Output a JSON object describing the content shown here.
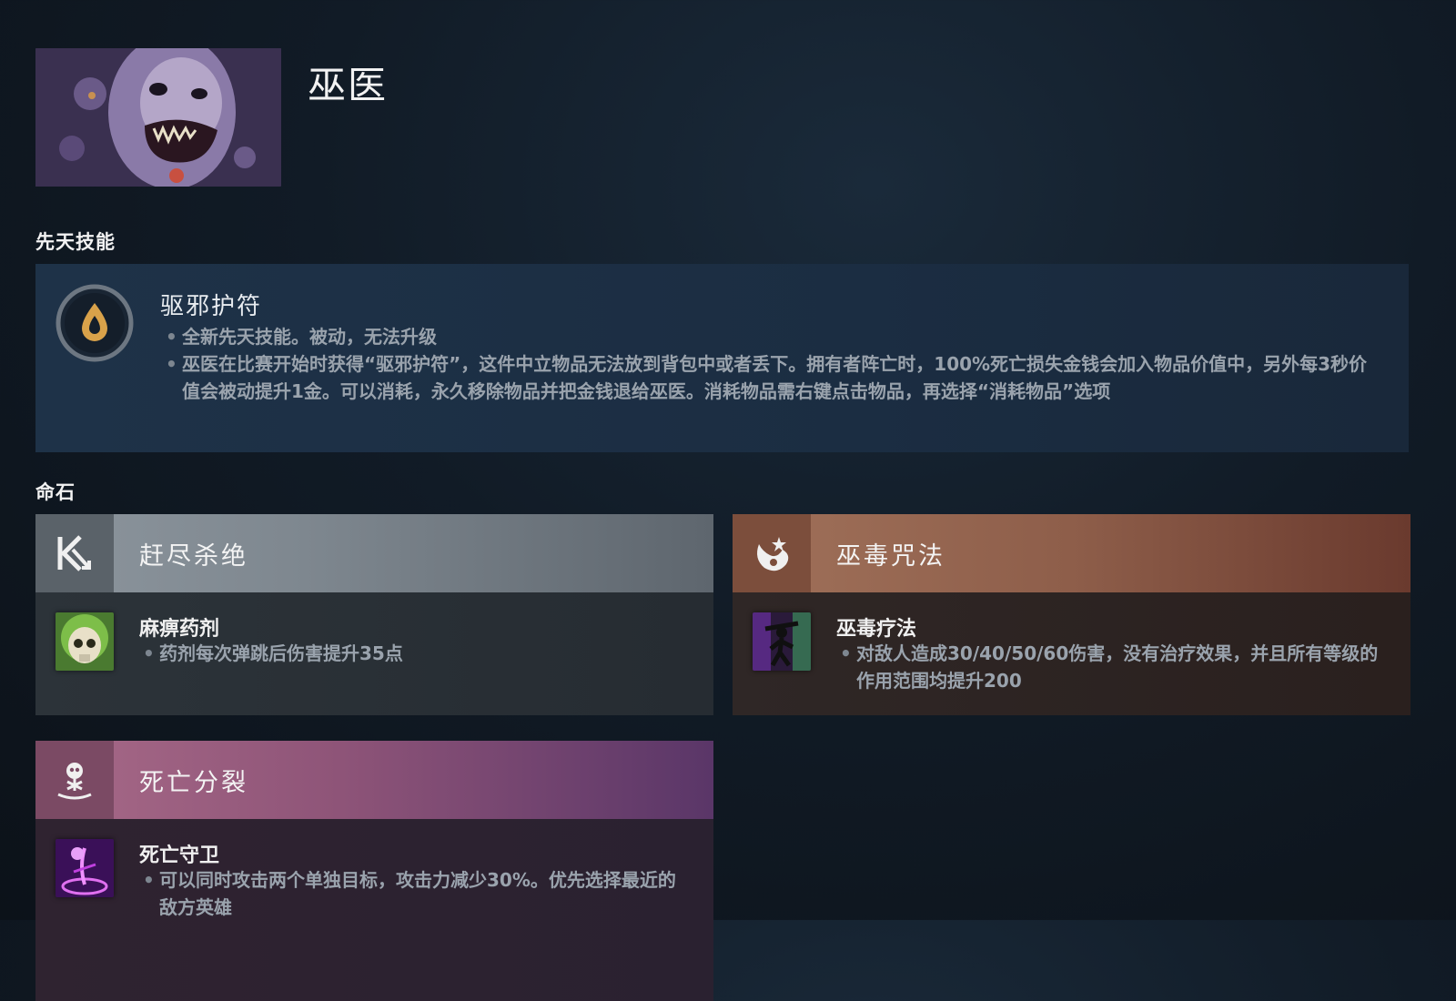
{
  "hero": {
    "name": "巫医"
  },
  "innate": {
    "section_title": "先天技能",
    "name": "驱邪护符",
    "bullets": [
      "全新先天技能。被动，无法升级",
      "巫医在比赛开始时获得“驱邪护符”，这件中立物品无法放到背包中或者丢下。拥有者阵亡时，100%死亡损失金钱会加入物品价值中，另外每3秒价值会被动提升1金。可以消耗，永久移除物品并把金钱退给巫医。消耗物品需右键点击物品，再选择“消耗物品”选项"
    ]
  },
  "facets": {
    "section_title": "命石",
    "items": [
      {
        "title": "赶尽杀绝",
        "icon": "arrow-strike-icon",
        "ability_name": "麻痹药剂",
        "ability_icon": "skull-potion-icon",
        "bullets": [
          "药剂每次弹跳后伤害提升35点"
        ]
      },
      {
        "title": "巫毒咒法",
        "icon": "flame-spiral-icon",
        "ability_name": "巫毒疗法",
        "ability_icon": "voodoo-figure-icon",
        "bullets": [
          "对敌人造成30/40/50/60伤害，没有治疗效果，并且所有等级的作用范围均提升200"
        ]
      },
      {
        "title": "死亡分裂",
        "icon": "skull-totem-icon",
        "ability_name": "死亡守卫",
        "ability_icon": "death-ward-icon",
        "bullets": [
          "可以同时攻击两个单独目标，攻击力减少30%。优先选择最近的敌方英雄"
        ]
      }
    ]
  }
}
